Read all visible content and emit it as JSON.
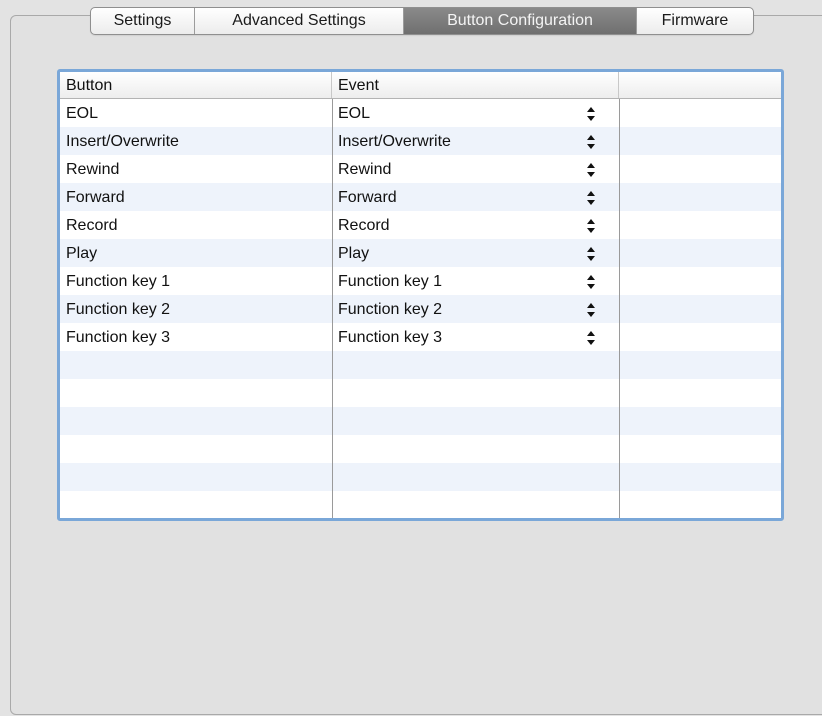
{
  "tabs": [
    {
      "label": "Settings",
      "selected": false
    },
    {
      "label": "Advanced Settings",
      "selected": false
    },
    {
      "label": "Button Configuration",
      "selected": true
    },
    {
      "label": "Firmware",
      "selected": false
    }
  ],
  "table": {
    "columns": [
      "Button",
      "Event",
      ""
    ],
    "rows": [
      {
        "button": "EOL",
        "event": "EOL"
      },
      {
        "button": "Insert/Overwrite",
        "event": "Insert/Overwrite"
      },
      {
        "button": "Rewind",
        "event": "Rewind"
      },
      {
        "button": "Forward",
        "event": "Forward"
      },
      {
        "button": "Record",
        "event": "Record"
      },
      {
        "button": "Play",
        "event": "Play"
      },
      {
        "button": "Function key 1",
        "event": "Function key 1"
      },
      {
        "button": "Function key 2",
        "event": "Function key 2"
      },
      {
        "button": "Function key 3",
        "event": "Function key 3"
      }
    ],
    "empty_rows": 6
  },
  "colors": {
    "focus_ring": "#7aa7d8",
    "alt_row": "#eef3fb",
    "selected_tab": "#7b7b7b",
    "window_bg": "#e3e3e3"
  },
  "icons": {
    "popup_indicator": "up-down-arrows-icon"
  }
}
